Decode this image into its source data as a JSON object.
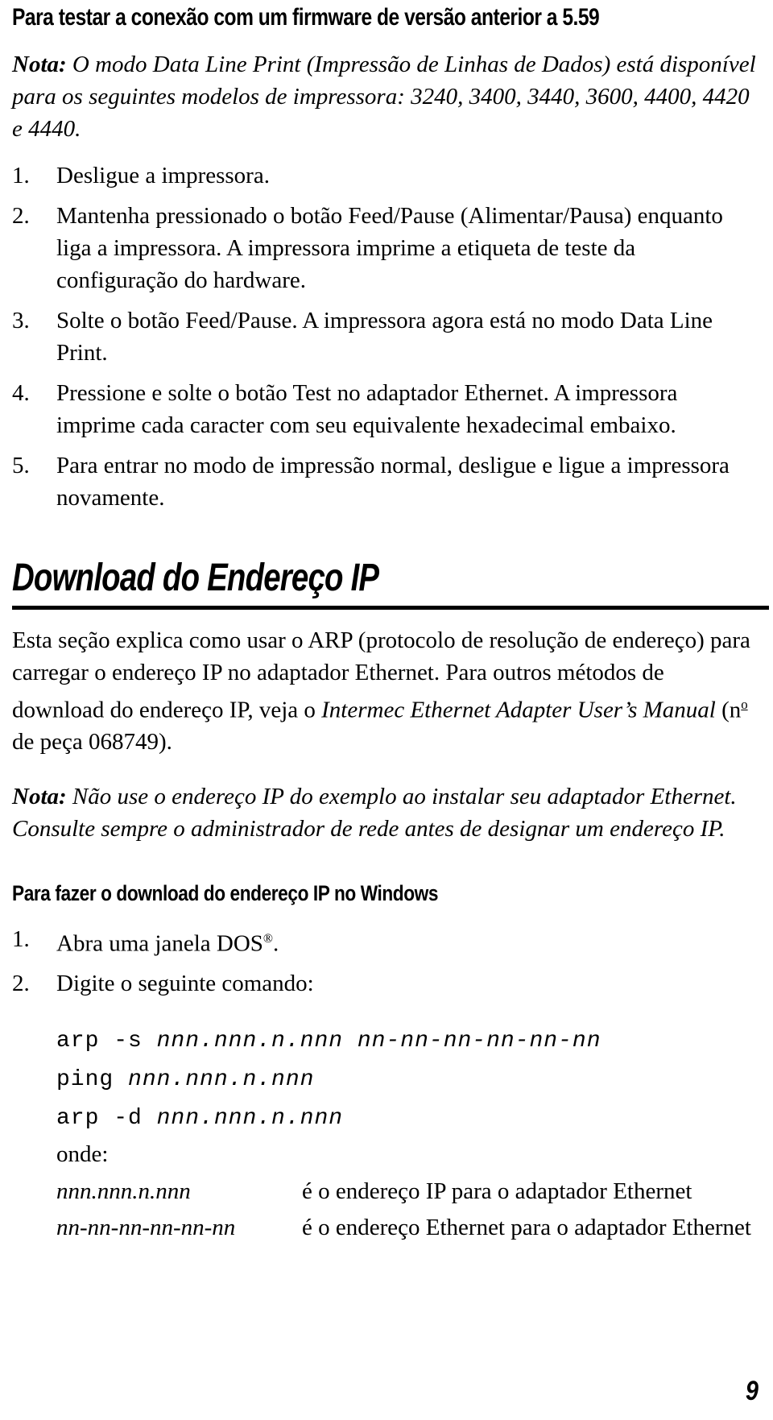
{
  "document": {
    "title_heading": "Para testar a conexão com um firmware de versão anterior a 5.59",
    "page_number": "9"
  },
  "note_top": {
    "label": "Nota:",
    "text": " O modo Data Line Print (Impressão de Linhas de Dados) está disponível para os seguintes modelos de impressora: 3240, 3400, 3440, 3600, 4400, 4420 e 4440."
  },
  "steps_test": [
    {
      "num": "1.",
      "text": "Desligue a impressora."
    },
    {
      "num": "2.",
      "text": "Mantenha pressionado o botão Feed/Pause (Alimentar/Pausa) enquanto liga a impressora. A impressora imprime a etiqueta de teste da configuração do hardware."
    },
    {
      "num": "3.",
      "text": "Solte o botão Feed/Pause. A impressora agora está no modo Data Line Print."
    },
    {
      "num": "4.",
      "text": "Pressione e solte o botão Test no adaptador Ethernet. A impressora imprime cada caracter com seu equivalente hexadecimal embaixo."
    },
    {
      "num": "5.",
      "text": "Para entrar no modo de impressão normal, desligue e ligue a impressora novamente."
    }
  ],
  "section": {
    "heading": "Download do Endereço IP",
    "intro_part1": "Esta seção explica como usar o ARP (protocolo de resolução de endereço) para carregar o endereço IP no adaptador Ethernet. Para outros métodos de download do endereço IP, veja o ",
    "intro_italic": "Intermec Ethernet Adapter User’s Manual",
    "intro_part2a": " (n",
    "intro_sup": "o",
    "intro_part2b": " de peça 068749)."
  },
  "note_ip": {
    "label": "Nota:",
    "text": " Não use o endereço IP do exemplo ao instalar seu adaptador Ethernet. Consulte sempre o administrador de rede antes de designar um endereço IP."
  },
  "subsection": {
    "heading": "Para fazer o download do endereço IP no Windows"
  },
  "steps_windows": [
    {
      "num": "1.",
      "text_before": "Abra uma janela DOS",
      "sup": "®",
      "text_after": "."
    },
    {
      "num": "2.",
      "text": "Digite o seguinte comando:"
    }
  ],
  "code": {
    "line1_cmd": "arp -s ",
    "line1_ph1": "nnn.nnn.n.nnn",
    "line1_sep": " ",
    "line1_ph2": "nn-nn-nn-nn-nn-nn",
    "line2_cmd": "ping ",
    "line2_ph1": "nnn.nnn.n.nnn",
    "line3_cmd": "arp -d ",
    "line3_ph1": "nnn.nnn.n.nnn",
    "where_label": "onde:"
  },
  "definitions": [
    {
      "term": "nnn.nnn.n.nnn",
      "desc": "é o endereço IP para o adaptador Ethernet"
    },
    {
      "term": "nn-nn-nn-nn-nn-nn",
      "desc": "é o endereço Ethernet para o adaptador Ethernet"
    }
  ]
}
